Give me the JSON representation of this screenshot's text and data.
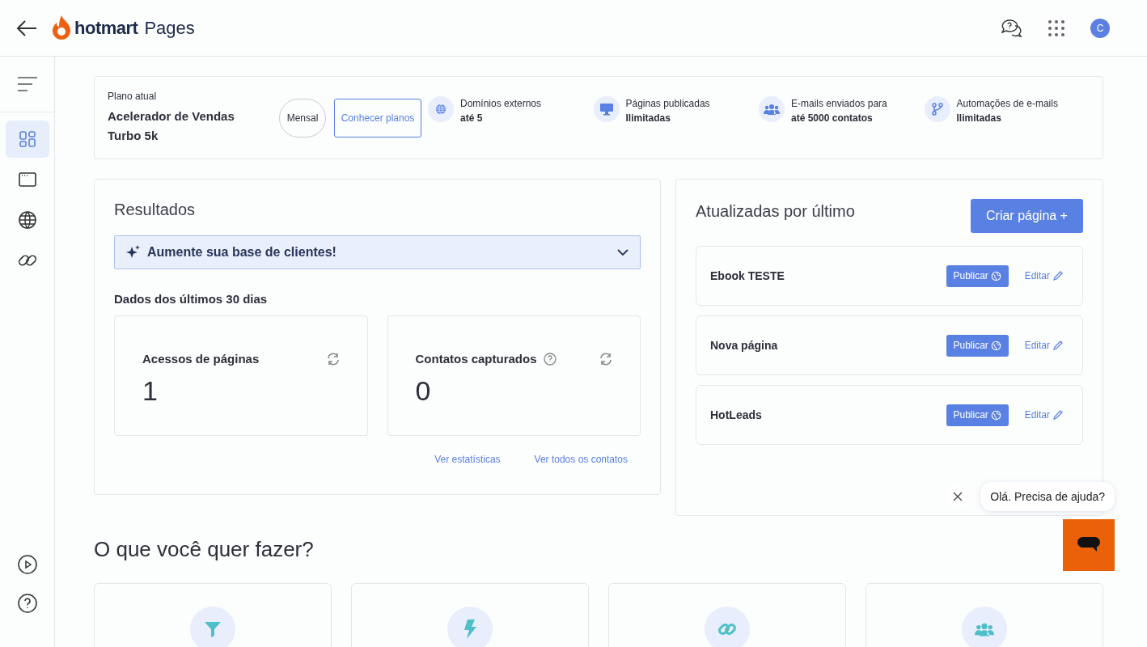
{
  "header": {
    "logo_word": "hotmart",
    "product": "Pages",
    "avatar": "C"
  },
  "sidebar": {
    "items": [
      {
        "selected": true
      },
      {
        "selected": false
      },
      {
        "selected": false
      },
      {
        "selected": false
      }
    ]
  },
  "plan": {
    "label": "Plano atual",
    "name": "Acelerador de Vendas Turbo 5k",
    "period": "Mensal",
    "cta": "Conhecer planos",
    "features": [
      {
        "kind": "globe",
        "label": "Domínios externos",
        "value": "até 5"
      },
      {
        "kind": "monitor",
        "label": "Páginas publicadas",
        "value": "Ilimitadas"
      },
      {
        "kind": "people",
        "label": "E-mails enviados para",
        "value": "até 5000 contatos"
      },
      {
        "kind": "branch",
        "label": "Automações de e-mails",
        "value": "Ilimitadas"
      }
    ]
  },
  "results": {
    "title": "Resultados",
    "banner": {
      "text": "Aumente sua base de clientes!",
      "expanded": false
    },
    "period": "Dados dos últimos 30 dias",
    "metrics": [
      {
        "label": "Acessos de páginas",
        "value": "1",
        "help": false
      },
      {
        "label": "Contatos capturados",
        "value": "0",
        "help": true
      }
    ],
    "links": [
      "Ver estatísticas",
      "Ver todos os contatos"
    ]
  },
  "recent": {
    "title": "Atualizadas por último",
    "create_button": "Criar página +",
    "pages": [
      {
        "name": "Ebook TESTE",
        "publish": "Publicar",
        "edit": "Editar"
      },
      {
        "name": "Nova página",
        "publish": "Publicar",
        "edit": "Editar"
      },
      {
        "name": "HotLeads",
        "publish": "Publicar",
        "edit": "Editar"
      }
    ]
  },
  "actions": {
    "title": "O que você quer fazer?",
    "cards": [
      {
        "kind": "funnel"
      },
      {
        "kind": "bolt"
      },
      {
        "kind": "link"
      },
      {
        "kind": "people"
      }
    ]
  },
  "chat": {
    "greeting": "Olá. Precisa de ajuda?"
  }
}
